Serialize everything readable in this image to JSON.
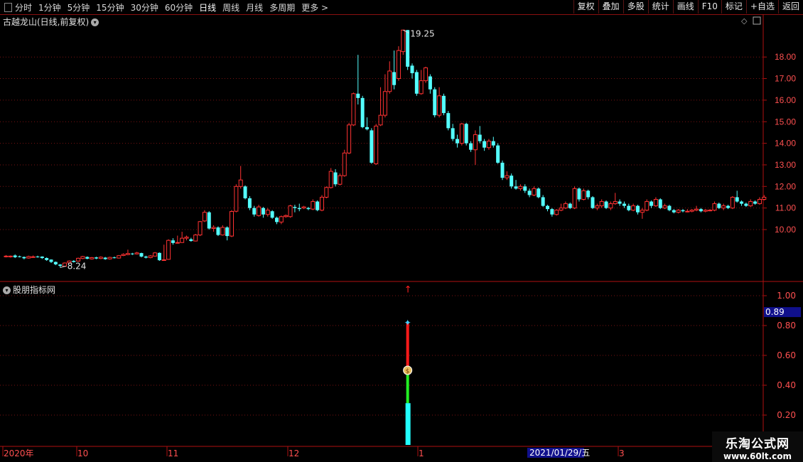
{
  "toolbar": {
    "periods": [
      "分时",
      "1分钟",
      "5分钟",
      "15分钟",
      "30分钟",
      "60分钟",
      "日线",
      "周线",
      "月线",
      "多周期",
      "更多 >"
    ],
    "active_period": "日线",
    "right_buttons": [
      "复权",
      "叠加",
      "多股",
      "统计",
      "画线",
      "F10",
      "标记",
      "+自选",
      "返回"
    ]
  },
  "main_chart": {
    "title": "古越龙山(日线,前复权)",
    "price_labels": [
      "18.00",
      "17.00",
      "16.00",
      "15.00",
      "14.00",
      "13.00",
      "12.00",
      "11.00",
      "10.00"
    ],
    "high_label": "19.25",
    "low_label": "8.24"
  },
  "indicator": {
    "title": "股朋指标网",
    "axis_labels": [
      "1.00",
      "0.80",
      "0.60",
      "0.40",
      "0.20"
    ],
    "current_value": "0.89"
  },
  "time_axis": {
    "labels": [
      "2020年",
      "10",
      "11",
      "12",
      "1",
      "3"
    ],
    "cursor_date": "2021/01/29/五"
  },
  "watermark": {
    "line1": "乐淘公式网",
    "line2": "www.60lt.com"
  },
  "colors": {
    "up": "#ff3232",
    "down": "#54ffff",
    "border": "#b01010",
    "cursor_bg": "#10108c"
  },
  "chart_data": {
    "type": "candlestick",
    "high": 19.25,
    "low": 8.24,
    "ylim": [
      9.0,
      19.6
    ],
    "candles": [
      [
        8.77,
        8.77,
        8.82,
        8.71
      ],
      [
        8.74,
        8.77,
        8.8,
        8.7
      ],
      [
        8.8,
        8.72,
        8.85,
        8.68
      ],
      [
        8.76,
        8.74,
        8.79,
        8.71
      ],
      [
        8.73,
        8.67,
        8.75,
        8.62
      ],
      [
        8.68,
        8.75,
        8.79,
        8.65
      ],
      [
        8.74,
        8.74,
        8.8,
        8.7
      ],
      [
        8.75,
        8.74,
        8.79,
        8.7
      ],
      [
        8.75,
        8.68,
        8.76,
        8.64
      ],
      [
        8.68,
        8.59,
        8.71,
        8.55
      ],
      [
        8.61,
        8.5,
        8.62,
        8.45
      ],
      [
        8.5,
        8.39,
        8.52,
        8.35
      ],
      [
        8.38,
        8.32,
        8.4,
        8.24
      ],
      [
        8.3,
        8.45,
        8.48,
        8.28
      ],
      [
        8.46,
        8.54,
        8.57,
        8.44
      ],
      [
        8.55,
        8.5,
        8.58,
        8.47
      ],
      [
        8.54,
        8.67,
        8.7,
        8.52
      ],
      [
        8.66,
        8.75,
        8.78,
        8.63
      ],
      [
        8.73,
        8.65,
        8.76,
        8.62
      ],
      [
        8.64,
        8.7,
        8.73,
        8.61
      ],
      [
        8.71,
        8.66,
        8.74,
        8.63
      ],
      [
        8.66,
        8.72,
        8.76,
        8.63
      ],
      [
        8.7,
        8.63,
        8.73,
        8.6
      ],
      [
        8.64,
        8.71,
        8.74,
        8.61
      ],
      [
        8.71,
        8.69,
        8.75,
        8.66
      ],
      [
        8.68,
        8.79,
        8.82,
        8.66
      ],
      [
        8.8,
        8.85,
        8.9,
        8.77
      ],
      [
        8.84,
        8.89,
        9.07,
        8.81
      ],
      [
        8.89,
        8.86,
        8.92,
        8.82
      ],
      [
        8.87,
        8.92,
        8.97,
        8.85
      ],
      [
        8.91,
        8.75,
        8.93,
        8.71
      ],
      [
        8.75,
        8.7,
        8.79,
        8.66
      ],
      [
        8.7,
        8.78,
        8.82,
        8.67
      ],
      [
        8.77,
        8.92,
        8.96,
        8.75
      ],
      [
        8.92,
        8.58,
        8.94,
        8.55
      ],
      [
        8.6,
        8.6,
        9.3,
        8.55
      ],
      [
        8.62,
        9.5,
        9.55,
        8.6
      ],
      [
        9.5,
        9.38,
        9.6,
        9.3
      ],
      [
        9.4,
        9.4,
        9.72,
        9.35
      ],
      [
        9.4,
        9.6,
        9.9,
        9.38
      ],
      [
        9.6,
        9.65,
        9.72,
        9.5
      ],
      [
        9.55,
        9.47,
        9.62,
        9.44
      ],
      [
        9.47,
        9.75,
        9.8,
        9.45
      ],
      [
        9.75,
        10.37,
        10.4,
        9.7
      ],
      [
        10.4,
        10.8,
        10.9,
        10.35
      ],
      [
        10.8,
        10.05,
        10.85,
        10.0
      ],
      [
        10.05,
        10.1,
        10.2,
        9.9
      ],
      [
        10.1,
        9.75,
        10.15,
        9.7
      ],
      [
        9.75,
        10.1,
        10.2,
        9.72
      ],
      [
        10.1,
        9.7,
        10.15,
        9.5
      ],
      [
        9.7,
        10.84,
        10.9,
        9.65
      ],
      [
        10.85,
        12.0,
        12.1,
        10.8
      ],
      [
        12.0,
        12.3,
        12.95,
        11.9
      ],
      [
        12.0,
        11.45,
        12.05,
        11.4
      ],
      [
        11.45,
        11.0,
        11.55,
        10.9
      ],
      [
        11.0,
        10.7,
        11.1,
        10.6
      ],
      [
        10.65,
        11.05,
        11.15,
        10.6
      ],
      [
        11.0,
        10.7,
        11.05,
        10.55
      ],
      [
        10.7,
        10.9,
        11.0,
        10.6
      ],
      [
        10.85,
        10.55,
        10.9,
        10.5
      ],
      [
        10.55,
        10.35,
        10.6,
        10.25
      ],
      [
        10.35,
        10.6,
        10.65,
        10.25
      ],
      [
        10.6,
        10.65,
        10.7,
        10.55
      ],
      [
        10.6,
        11.1,
        11.15,
        10.55
      ],
      [
        11.05,
        11.0,
        11.15,
        10.8
      ],
      [
        11.0,
        10.95,
        11.2,
        10.85
      ],
      [
        11.0,
        11.05,
        11.1,
        10.95
      ],
      [
        11.0,
        10.95,
        11.05,
        10.9
      ],
      [
        10.95,
        11.3,
        11.4,
        10.9
      ],
      [
        11.3,
        10.9,
        11.35,
        10.85
      ],
      [
        10.9,
        11.5,
        11.6,
        10.85
      ],
      [
        11.5,
        11.95,
        12.0,
        11.45
      ],
      [
        11.95,
        12.7,
        12.85,
        11.9
      ],
      [
        12.65,
        12.1,
        12.8,
        12.0
      ],
      [
        12.1,
        12.5,
        12.6,
        12.05
      ],
      [
        12.5,
        13.55,
        13.7,
        12.45
      ],
      [
        13.55,
        14.85,
        14.95,
        13.5
      ],
      [
        14.85,
        16.3,
        16.35,
        14.8
      ],
      [
        16.3,
        16.1,
        18.1,
        15.8
      ],
      [
        16.1,
        14.75,
        16.2,
        14.7
      ],
      [
        14.75,
        14.65,
        15.2,
        14.6
      ],
      [
        14.6,
        13.1,
        14.7,
        13.05
      ],
      [
        13.05,
        14.8,
        14.9,
        13.0
      ],
      [
        14.85,
        15.3,
        16.6,
        14.8
      ],
      [
        15.3,
        16.4,
        17.2,
        15.2
      ],
      [
        16.4,
        17.35,
        17.8,
        16.3
      ],
      [
        17.3,
        16.7,
        18.3,
        16.5
      ],
      [
        17.0,
        18.3,
        18.5,
        16.9
      ],
      [
        18.25,
        19.25,
        19.25,
        18.1
      ],
      [
        19.25,
        17.55,
        19.25,
        17.4
      ],
      [
        17.6,
        17.25,
        17.7,
        17.0
      ],
      [
        17.3,
        16.3,
        17.4,
        16.2
      ],
      [
        16.3,
        16.9,
        17.4,
        16.25
      ],
      [
        16.9,
        17.5,
        17.55,
        16.8
      ],
      [
        17.1,
        16.5,
        17.2,
        16.3
      ],
      [
        16.5,
        15.3,
        16.6,
        15.2
      ],
      [
        15.3,
        16.2,
        16.6,
        15.2
      ],
      [
        16.2,
        15.4,
        16.3,
        15.3
      ],
      [
        15.4,
        14.7,
        15.5,
        14.6
      ],
      [
        14.7,
        14.2,
        14.9,
        14.1
      ],
      [
        14.2,
        14.0,
        14.4,
        13.8
      ],
      [
        14.0,
        14.9,
        14.95,
        13.9
      ],
      [
        14.9,
        14.0,
        14.95,
        13.9
      ],
      [
        14.0,
        13.7,
        14.1,
        13.6
      ],
      [
        13.7,
        14.4,
        14.6,
        13.0
      ],
      [
        14.4,
        14.1,
        14.8,
        14.0
      ],
      [
        14.1,
        13.8,
        14.2,
        13.65
      ],
      [
        13.8,
        14.1,
        14.2,
        13.7
      ],
      [
        14.1,
        13.9,
        14.3,
        13.8
      ],
      [
        13.9,
        13.1,
        14.0,
        13.05
      ],
      [
        13.1,
        12.4,
        13.2,
        12.3
      ],
      [
        12.4,
        12.5,
        12.7,
        12.3
      ],
      [
        12.5,
        12.0,
        12.6,
        11.9
      ],
      [
        12.0,
        11.9,
        12.3,
        11.85
      ],
      [
        11.9,
        12.0,
        12.1,
        11.8
      ],
      [
        12.0,
        11.8,
        12.1,
        11.7
      ],
      [
        11.8,
        11.6,
        11.9,
        11.5
      ],
      [
        11.6,
        11.9,
        12.0,
        11.55
      ],
      [
        11.9,
        11.5,
        11.95,
        11.45
      ],
      [
        11.5,
        11.1,
        11.6,
        11.05
      ],
      [
        11.1,
        10.95,
        11.15,
        10.85
      ],
      [
        10.95,
        10.7,
        11.0,
        10.6
      ],
      [
        10.7,
        10.9,
        10.95,
        10.65
      ],
      [
        10.9,
        11.0,
        11.2,
        10.85
      ],
      [
        11.0,
        11.2,
        11.3,
        10.95
      ],
      [
        11.2,
        11.0,
        11.25,
        10.95
      ],
      [
        11.0,
        11.9,
        12.0,
        10.95
      ],
      [
        11.9,
        11.4,
        11.95,
        11.3
      ],
      [
        11.4,
        11.8,
        11.9,
        11.35
      ],
      [
        11.8,
        11.5,
        11.85,
        11.4
      ],
      [
        11.5,
        11.0,
        11.55,
        10.95
      ],
      [
        11.0,
        11.1,
        11.2,
        10.9
      ],
      [
        11.1,
        11.3,
        11.4,
        11.0
      ],
      [
        11.3,
        11.0,
        11.35,
        10.95
      ],
      [
        11.0,
        11.2,
        11.3,
        10.9
      ],
      [
        11.2,
        11.3,
        11.7,
        11.15
      ],
      [
        11.3,
        11.2,
        11.4,
        11.1
      ],
      [
        11.2,
        11.1,
        11.3,
        11.0
      ],
      [
        11.1,
        10.9,
        11.2,
        10.85
      ],
      [
        10.9,
        11.1,
        11.2,
        10.85
      ],
      [
        11.1,
        10.8,
        11.15,
        10.7
      ],
      [
        10.8,
        10.9,
        11.0,
        10.5
      ],
      [
        10.9,
        11.3,
        11.4,
        10.85
      ],
      [
        11.3,
        11.1,
        11.35,
        11.0
      ],
      [
        11.1,
        11.4,
        11.5,
        11.05
      ],
      [
        11.4,
        11.0,
        11.45,
        10.95
      ],
      [
        11.0,
        11.1,
        11.2,
        10.95
      ],
      [
        11.1,
        10.9,
        11.15,
        10.85
      ],
      [
        10.9,
        10.8,
        10.95,
        10.75
      ],
      [
        10.8,
        10.9,
        10.95,
        10.75
      ],
      [
        10.9,
        10.85,
        10.95,
        10.8
      ],
      [
        10.85,
        10.85,
        10.95,
        10.8
      ],
      [
        10.85,
        10.9,
        10.95,
        10.8
      ],
      [
        10.9,
        10.95,
        11.1,
        10.85
      ],
      [
        10.95,
        10.85,
        11.0,
        10.8
      ],
      [
        10.85,
        10.9,
        10.95,
        10.8
      ],
      [
        10.9,
        10.9,
        10.95,
        10.85
      ],
      [
        10.9,
        11.2,
        11.3,
        10.85
      ],
      [
        11.2,
        11.0,
        11.25,
        10.95
      ],
      [
        11.0,
        11.1,
        11.2,
        10.9
      ],
      [
        11.1,
        11.0,
        11.15,
        10.95
      ],
      [
        11.0,
        11.5,
        11.55,
        10.95
      ],
      [
        11.5,
        11.3,
        11.8,
        11.25
      ],
      [
        11.3,
        11.2,
        11.35,
        11.1
      ],
      [
        11.2,
        11.1,
        11.25,
        11.05
      ],
      [
        11.1,
        11.3,
        11.4,
        11.05
      ],
      [
        11.3,
        11.2,
        11.35,
        11.15
      ],
      [
        11.2,
        11.4,
        11.5,
        11.15
      ],
      [
        11.4,
        11.5,
        11.6,
        11.35
      ]
    ]
  },
  "indicator_data": {
    "signal_index": 89,
    "signal_value": 0.89
  }
}
